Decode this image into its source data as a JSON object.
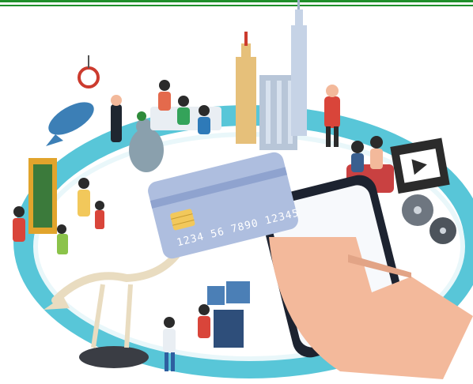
{
  "colors": {
    "rule": "#1f8f2a",
    "ring": "#58c6d8",
    "ring_dark": "#2aa7bd",
    "card": "#aebedf",
    "card_dark": "#8fa3cf",
    "chip": "#f2c85b",
    "skin": "#f3b99b",
    "phone": "#1d2330",
    "screen": "#f7f9fc"
  },
  "icons": {
    "card": "credit-card-icon",
    "phone": "smartphone-icon",
    "film": "film-strip-icon",
    "reel": "film-reel-icon"
  },
  "card": {
    "number_text": "1234 56 7890 12345"
  }
}
